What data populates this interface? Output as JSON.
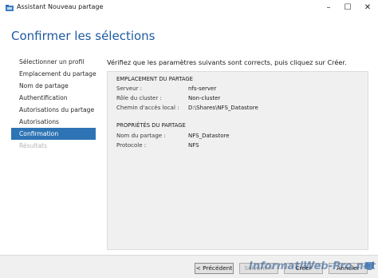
{
  "window": {
    "title": "Assistant Nouveau partage",
    "controls": {
      "minimize": "–",
      "maximize": "☐",
      "close": "✕"
    }
  },
  "page_title": "Confirmer les sélections",
  "nav": {
    "items": [
      {
        "label": "Sélectionner un profil",
        "state": "normal"
      },
      {
        "label": "Emplacement du partage",
        "state": "normal"
      },
      {
        "label": "Nom de partage",
        "state": "normal"
      },
      {
        "label": "Authentification",
        "state": "normal"
      },
      {
        "label": "Autorisations du partage",
        "state": "normal"
      },
      {
        "label": "Autorisations",
        "state": "normal"
      },
      {
        "label": "Confirmation",
        "state": "selected"
      },
      {
        "label": "Résultats",
        "state": "disabled"
      }
    ]
  },
  "instructions": "Vérifiez que les paramètres suivants sont corrects, puis cliquez sur Créer.",
  "sections": {
    "location": {
      "title": "EMPLACEMENT DU PARTAGE",
      "rows": [
        {
          "label": "Serveur :",
          "value": "nfs-server"
        },
        {
          "label": "Rôle du cluster :",
          "value": "Non-cluster"
        },
        {
          "label": "Chemin d'accès local :",
          "value": "D:\\Shares\\NFS_Datastore"
        }
      ]
    },
    "properties": {
      "title": "PROPRIÉTÉS DU PARTAGE",
      "rows": [
        {
          "label": "Nom du partage :",
          "value": "NFS_Datastore"
        },
        {
          "label": "Protocole :",
          "value": "NFS"
        }
      ]
    }
  },
  "buttons": {
    "previous": "< Précédent",
    "next": "Suivant >",
    "create": "Créer",
    "cancel": "Annuler"
  },
  "watermark": "InformatiWeb-Pro.net",
  "colors": {
    "accent": "#2e74b5",
    "title_blue": "#1e5aa0",
    "panel_bg": "#f0f0f0"
  }
}
